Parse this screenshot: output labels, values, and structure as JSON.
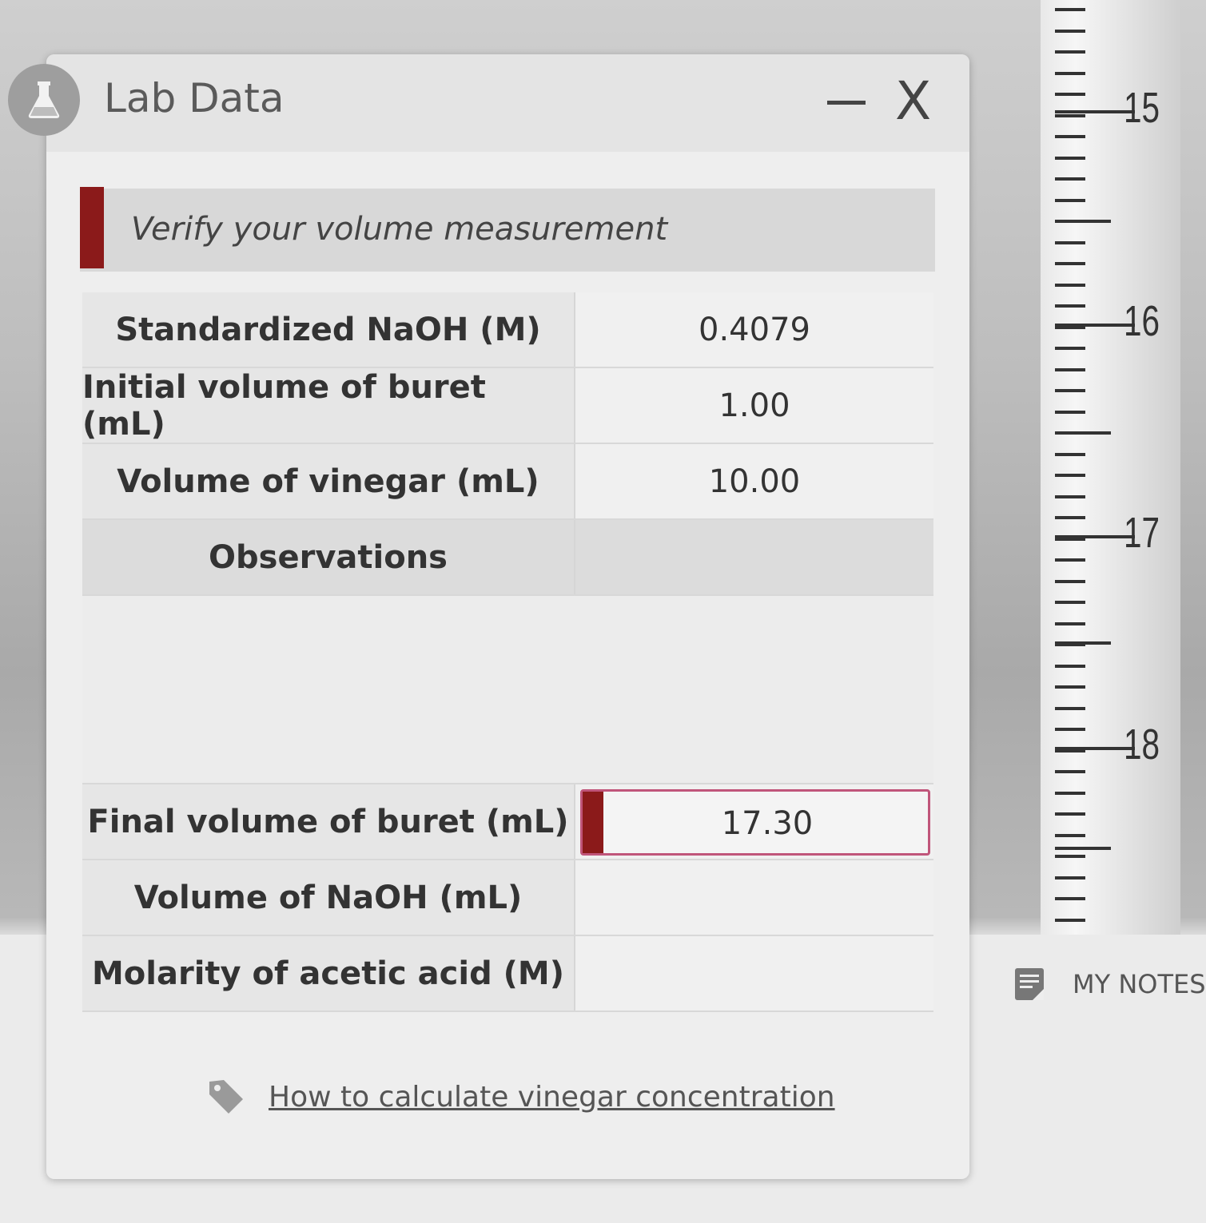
{
  "window": {
    "title": "Lab Data",
    "minimize_icon": "minus-icon",
    "close_label": "X"
  },
  "alert": {
    "text": "Verify your volume measurement",
    "accent_color": "#8b1a1a"
  },
  "table": {
    "rows": [
      {
        "label": "Standardized NaOH (M)",
        "value": "0.4079"
      },
      {
        "label": "Initial volume of buret (mL)",
        "value": "1.00"
      },
      {
        "label": "Volume of vinegar (mL)",
        "value": "10.00"
      }
    ],
    "observations_label": "Observations",
    "final_volume": {
      "label": "Final volume of buret (mL)",
      "value": "17.30"
    },
    "naoh_volume": {
      "label": "Volume of NaOH (mL)",
      "value": ""
    },
    "molarity": {
      "label": "Molarity of acetic acid (M)",
      "value": ""
    }
  },
  "help": {
    "icon": "tag-icon",
    "link_text": "How to calculate vinegar concentration"
  },
  "buret": {
    "scale_labels": [
      "15",
      "16",
      "17",
      "18"
    ]
  },
  "notes": {
    "icon": "notes-icon",
    "label": "MY NOTES"
  }
}
